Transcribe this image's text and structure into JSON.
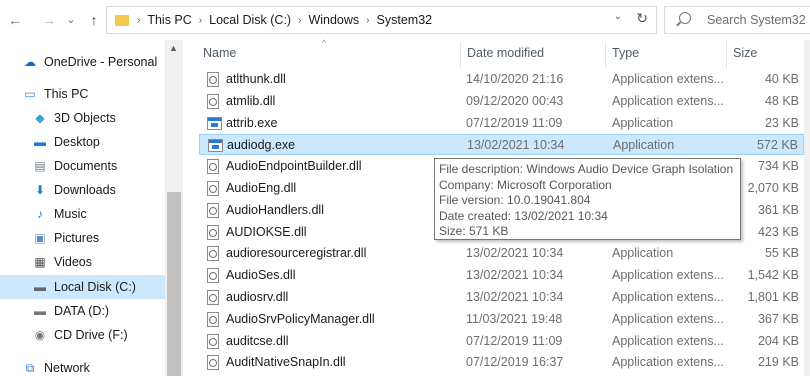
{
  "window": {
    "back_glyph": "←",
    "forward_glyph": "→",
    "recent_glyph": "⌄",
    "up_glyph": "↑",
    "dropdown_glyph": "⌄",
    "refresh_glyph": "↻",
    "crumb_sep": "›"
  },
  "breadcrumb": [
    "This PC",
    "Local Disk (C:)",
    "Windows",
    "System32"
  ],
  "search": {
    "placeholder": "Search System32"
  },
  "sidebar": {
    "items": [
      {
        "label": "OneDrive - Personal",
        "icon": "cloud-icon",
        "color": "#0f6cbd"
      },
      {
        "label": "This PC",
        "icon": "computer-icon",
        "color": "#3a8ee6"
      },
      {
        "label": "3D Objects",
        "icon": "cube-icon",
        "color": "#36a3e0"
      },
      {
        "label": "Desktop",
        "icon": "desktop-icon",
        "color": "#1e7bd6"
      },
      {
        "label": "Documents",
        "icon": "document-icon",
        "color": "#6f7c8a"
      },
      {
        "label": "Downloads",
        "icon": "download-icon",
        "color": "#1e7bd6"
      },
      {
        "label": "Music",
        "icon": "music-icon",
        "color": "#1e7bd6"
      },
      {
        "label": "Pictures",
        "icon": "pictures-icon",
        "color": "#5b8bb8"
      },
      {
        "label": "Videos",
        "icon": "video-icon",
        "color": "#555"
      },
      {
        "label": "Local Disk (C:)",
        "icon": "drive-icon",
        "color": "#666",
        "selected": true
      },
      {
        "label": "DATA (D:)",
        "icon": "drive-icon",
        "color": "#777"
      },
      {
        "label": "CD Drive (F:)",
        "icon": "cd-icon",
        "color": "#777"
      },
      {
        "label": "Network",
        "icon": "network-icon",
        "color": "#2b7bd6"
      }
    ]
  },
  "columns": {
    "name": "Name",
    "date": "Date modified",
    "type": "Type",
    "size": "Size"
  },
  "files": [
    {
      "name": "atlthunk.dll",
      "date": "14/10/2020 21:16",
      "type": "Application extens...",
      "size": "40 KB",
      "kind": "dll"
    },
    {
      "name": "atmlib.dll",
      "date": "09/12/2020 00:43",
      "type": "Application extens...",
      "size": "48 KB",
      "kind": "dll"
    },
    {
      "name": "attrib.exe",
      "date": "07/12/2019 11:09",
      "type": "Application",
      "size": "23 KB",
      "kind": "exe"
    },
    {
      "name": "audiodg.exe",
      "date": "13/02/2021 10:34",
      "type": "Application",
      "size": "572 KB",
      "kind": "exe",
      "selected": true
    },
    {
      "name": "AudioEndpointBuilder.dll",
      "date": "",
      "type": "",
      "size": "734 KB",
      "kind": "dll"
    },
    {
      "name": "AudioEng.dll",
      "date": "",
      "type": "",
      "size": "2,070 KB",
      "kind": "dll"
    },
    {
      "name": "AudioHandlers.dll",
      "date": "",
      "type": "",
      "size": "361 KB",
      "kind": "dll"
    },
    {
      "name": "AUDIOKSE.dll",
      "date": "",
      "type": "",
      "size": "423 KB",
      "kind": "dll"
    },
    {
      "name": "audioresourceregistrar.dll",
      "date": "13/02/2021 10:34",
      "type": "Application",
      "size": "55 KB",
      "kind": "dll"
    },
    {
      "name": "AudioSes.dll",
      "date": "13/02/2021 10:34",
      "type": "Application extens...",
      "size": "1,542 KB",
      "kind": "dll"
    },
    {
      "name": "audiosrv.dll",
      "date": "13/02/2021 10:34",
      "type": "Application extens...",
      "size": "1,801 KB",
      "kind": "dll"
    },
    {
      "name": "AudioSrvPolicyManager.dll",
      "date": "11/03/2021 19:48",
      "type": "Application extens...",
      "size": "367 KB",
      "kind": "dll"
    },
    {
      "name": "auditcse.dll",
      "date": "07/12/2019 11:09",
      "type": "Application extens...",
      "size": "204 KB",
      "kind": "dll"
    },
    {
      "name": "AuditNativeSnapIn.dll",
      "date": "07/12/2019 16:37",
      "type": "Application extens...",
      "size": "219 KB",
      "kind": "dll"
    }
  ],
  "tooltip": {
    "lines": [
      "File description: Windows Audio Device Graph Isolation",
      "Company: Microsoft Corporation",
      "File version: 10.0.19041.804",
      "Date created: 13/02/2021 10:34",
      "Size: 571 KB"
    ]
  }
}
